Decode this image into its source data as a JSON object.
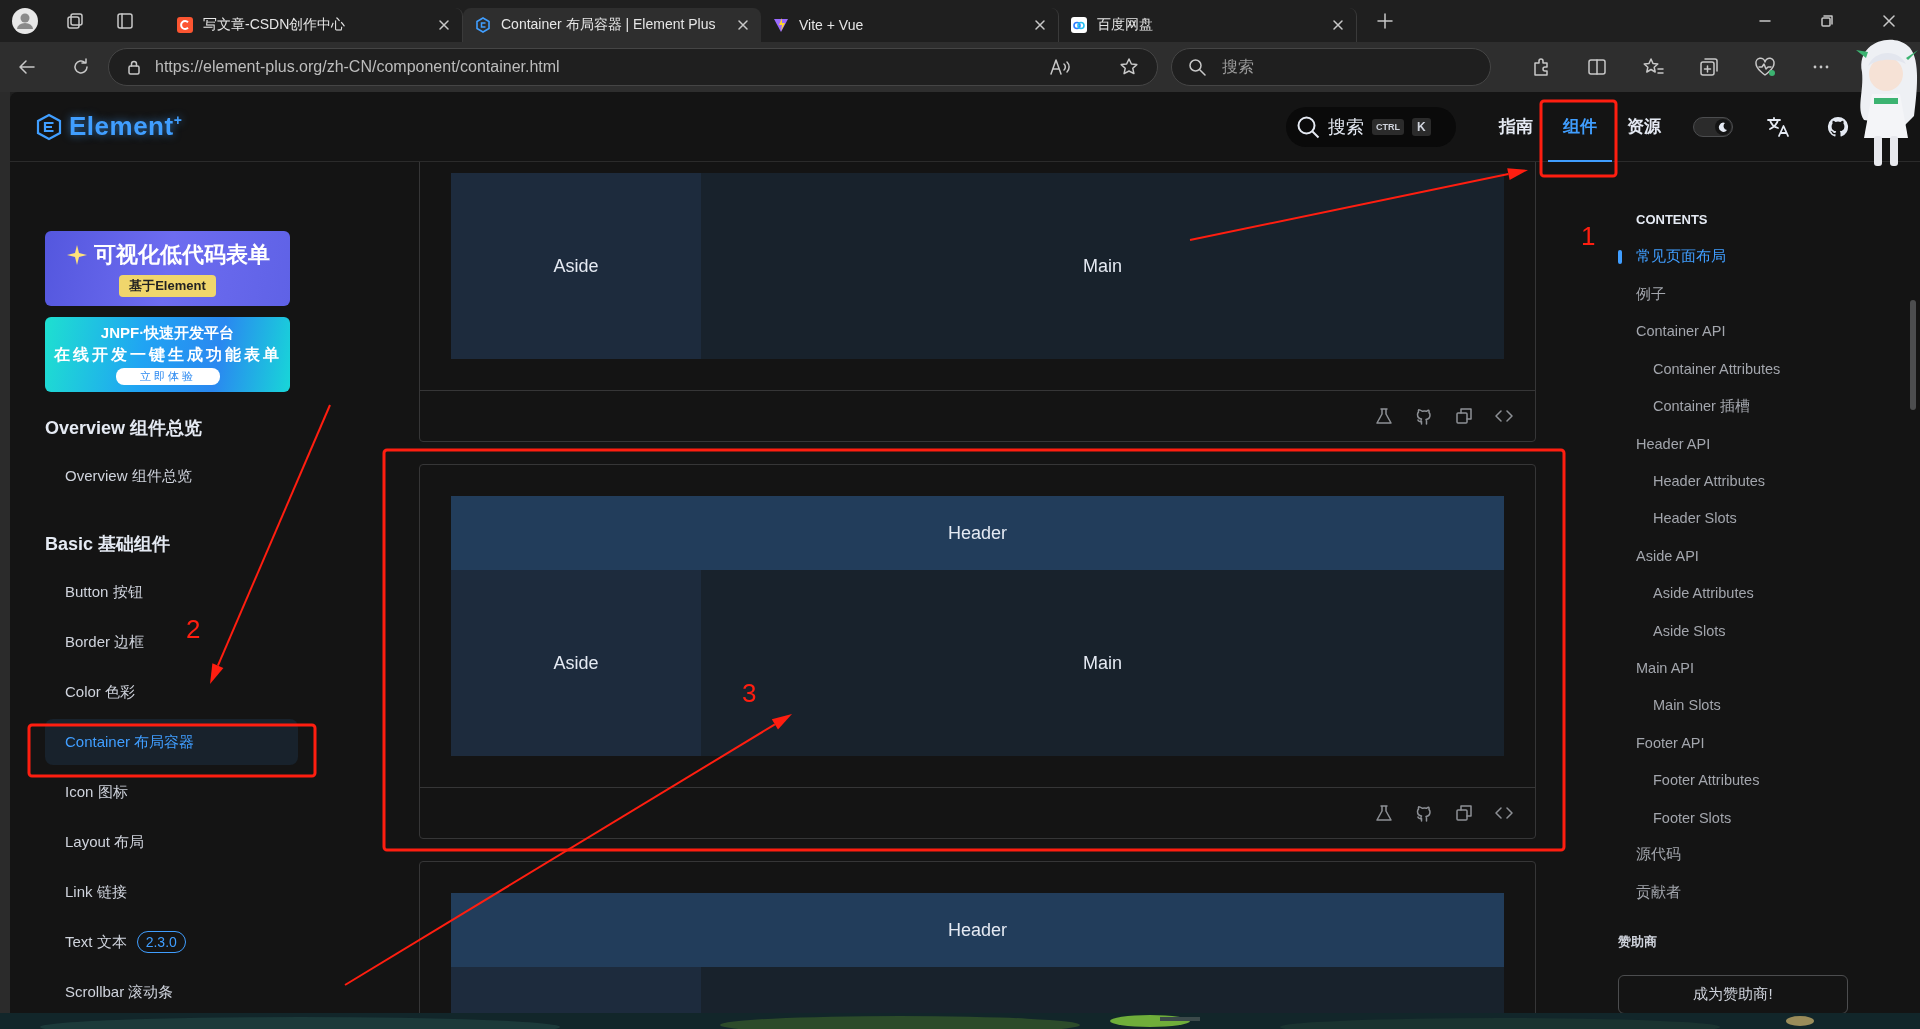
{
  "browser": {
    "tabs": [
      {
        "title": "写文章-CSDN创作中心",
        "selected": false
      },
      {
        "title": "Container 布局容器 | Element Plus",
        "selected": true
      },
      {
        "title": "Vite + Vue",
        "selected": false
      },
      {
        "title": "百度网盘",
        "selected": false
      }
    ],
    "address": "https://element-plus.org/zh-CN/component/container.html",
    "search_placeholder": "搜索"
  },
  "site_header": {
    "logo": "Element$^{+}$",
    "search": {
      "label": "搜索",
      "keys": [
        "CTRL",
        "K"
      ]
    },
    "nav": [
      {
        "label": "指南",
        "selected": false
      },
      {
        "label": "组件",
        "selected": true
      },
      {
        "label": "资源",
        "selected": false
      }
    ],
    "dark_theme": true
  },
  "sidebar": {
    "banners": [
      {
        "title": "可视化低代码表单",
        "tag": "基于Element"
      },
      {
        "title": "JNPF·快速开发平台",
        "subtitle": "在线开发一键生成功能表单",
        "tag": "立即体验"
      }
    ],
    "groups": [
      {
        "title": "Overview 组件总览",
        "items": [
          {
            "label": "Overview 组件总览",
            "selected": false
          }
        ]
      },
      {
        "title": "Basic 基础组件",
        "items": [
          {
            "label": "Button 按钮",
            "selected": false
          },
          {
            "label": "Border 边框",
            "selected": false
          },
          {
            "label": "Color 色彩",
            "selected": false
          },
          {
            "label": "Container 布局容器",
            "selected": true
          },
          {
            "label": "Icon 图标",
            "selected": false
          },
          {
            "label": "Layout 布局",
            "selected": false
          },
          {
            "label": "Link 链接",
            "selected": false
          },
          {
            "label": "Text 文本",
            "selected": false,
            "badge": "2.3.0"
          },
          {
            "label": "Scrollbar 滚动条",
            "selected": false
          }
        ]
      }
    ]
  },
  "demos": [
    {
      "aside": "Aside",
      "main": "Main",
      "toolbar": true
    },
    {
      "header": "Header",
      "aside": "Aside",
      "main": "Main",
      "toolbar": true
    },
    {
      "header": "Header",
      "toolbar": false
    }
  ],
  "toc": {
    "title": "CONTENTS",
    "items": [
      {
        "label": "常见页面布局",
        "selected": true
      },
      {
        "label": "例子",
        "selected": false
      },
      {
        "label": "Container API",
        "selected": false,
        "children": [
          {
            "label": "Container Attributes",
            "selected": false
          },
          {
            "label": "Container 插槽",
            "selected": false
          }
        ]
      },
      {
        "label": "Header API",
        "selected": false,
        "children": [
          {
            "label": "Header Attributes",
            "selected": false
          },
          {
            "label": "Header Slots",
            "selected": false
          }
        ]
      },
      {
        "label": "Aside API",
        "selected": false,
        "children": [
          {
            "label": "Aside Attributes",
            "selected": false
          },
          {
            "label": "Aside Slots",
            "selected": false
          }
        ]
      },
      {
        "label": "Main API",
        "selected": false,
        "children": [
          {
            "label": "Main Slots",
            "selected": false
          }
        ]
      },
      {
        "label": "Footer API",
        "selected": false,
        "children": [
          {
            "label": "Footer Attributes",
            "selected": false
          },
          {
            "label": "Footer Slots",
            "selected": false
          }
        ]
      },
      {
        "label": "源代码",
        "selected": false
      },
      {
        "label": "贡献者",
        "selected": false
      }
    ],
    "sponsors": {
      "title": "赞助商",
      "button": "成为赞助商!"
    }
  },
  "annotations": [
    {
      "number": "1"
    },
    {
      "number": "2"
    },
    {
      "number": "3"
    }
  ]
}
